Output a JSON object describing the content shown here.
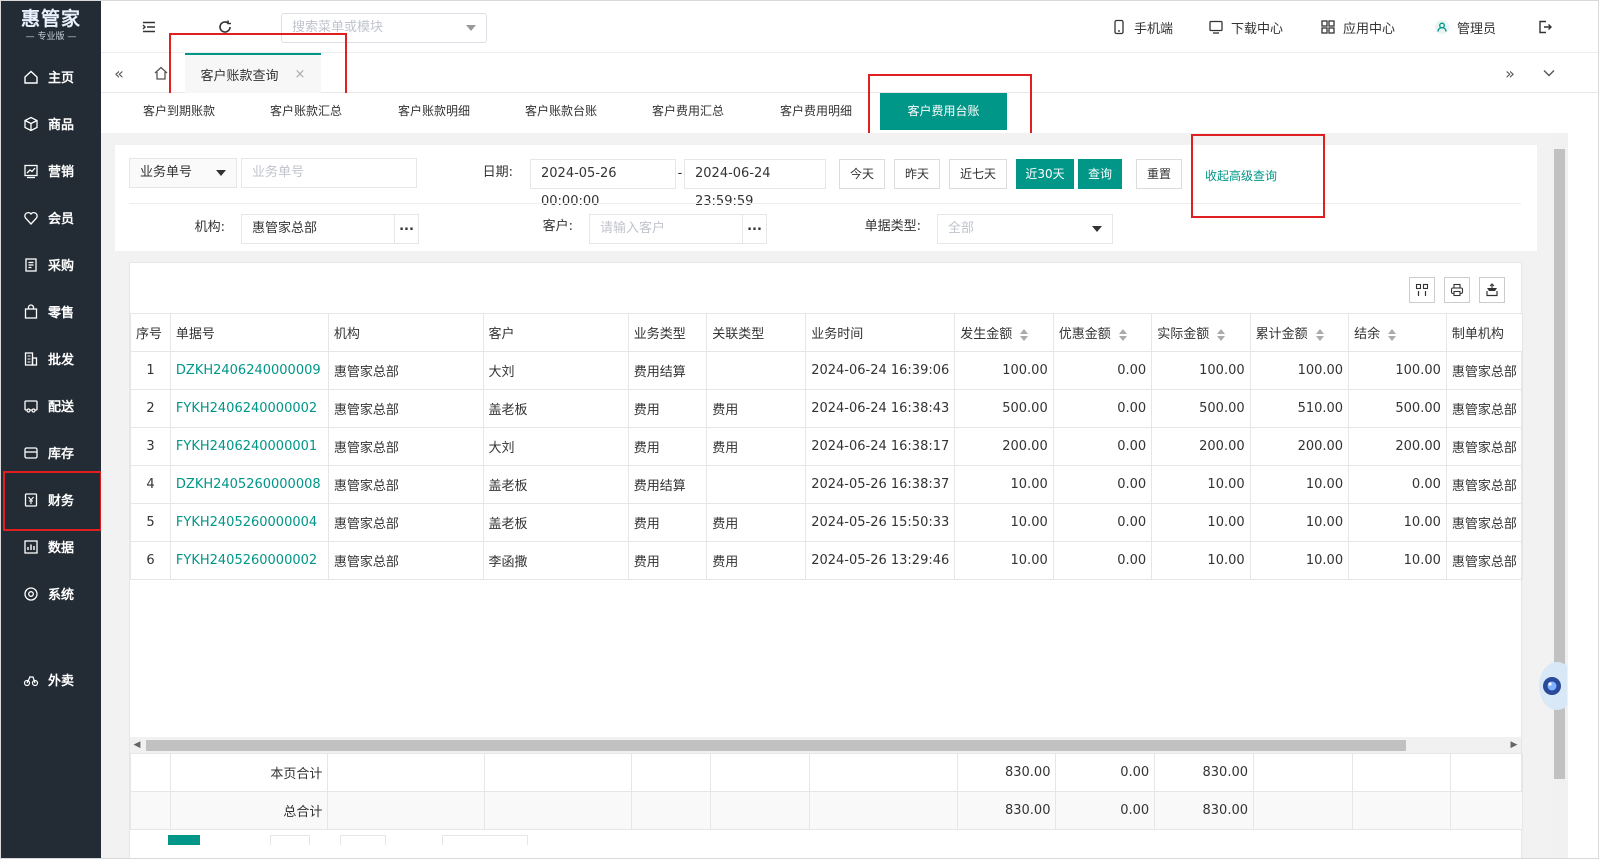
{
  "logo": {
    "main": "惠管家",
    "sub": "— 专业版 —"
  },
  "sidebar": {
    "items": [
      {
        "label": "主页",
        "icon": "home-icon"
      },
      {
        "label": "商品",
        "icon": "box-icon"
      },
      {
        "label": "营销",
        "icon": "chart-icon"
      },
      {
        "label": "会员",
        "icon": "heart-icon"
      },
      {
        "label": "采购",
        "icon": "purchase-icon"
      },
      {
        "label": "零售",
        "icon": "bag-icon"
      },
      {
        "label": "批发",
        "icon": "building-icon"
      },
      {
        "label": "配送",
        "icon": "delivery-icon"
      },
      {
        "label": "库存",
        "icon": "inventory-icon"
      },
      {
        "label": "财务",
        "icon": "yuan-icon"
      },
      {
        "label": "数据",
        "icon": "data-icon"
      },
      {
        "label": "系统",
        "icon": "settings-icon"
      },
      {
        "label": "外卖",
        "icon": "bike-icon"
      }
    ]
  },
  "header": {
    "search_placeholder": "搜索菜单或模块",
    "mobile": "手机端",
    "download": "下载中心",
    "apps": "应用中心",
    "user": "管理员"
  },
  "tabbar": {
    "active_tab": "客户账款查询",
    "close": "×"
  },
  "subtabs": [
    "客户到期账款",
    "客户账款汇总",
    "客户账款明细",
    "客户账款台账",
    "客户费用汇总",
    "客户费用明细",
    "客户费用台账"
  ],
  "filters": {
    "field_select": "业务单号",
    "field_placeholder": "业务单号",
    "date_label": "日期:",
    "date_start": "2024-05-26 00:00:00",
    "date_sep": "-",
    "date_end": "2024-06-24 23:59:59",
    "today": "今天",
    "yesterday": "昨天",
    "last7": "近七天",
    "last30": "近30天",
    "query": "查询",
    "reset": "重置",
    "collapse": "收起高级查询",
    "org_label": "机构:",
    "org_value": "惠管家总部",
    "customer_label": "客户:",
    "customer_placeholder": "请输入客户",
    "doctype_label": "单据类型:",
    "doctype_value": "全部",
    "dots": "..."
  },
  "table": {
    "columns": [
      "序号",
      "单据号",
      "机构",
      "客户",
      "业务类型",
      "关联类型",
      "业务时间",
      "发生金额",
      "优惠金额",
      "实际金额",
      "累计金额",
      "结余",
      "制单机构"
    ],
    "rows": [
      [
        "1",
        "DZKH2406240000009",
        "惠管家总部",
        "大刘",
        "费用结算",
        "",
        "2024-06-24 16:39:06",
        "100.00",
        "0.00",
        "100.00",
        "100.00",
        "100.00",
        "惠管家总部"
      ],
      [
        "2",
        "FYKH2406240000002",
        "惠管家总部",
        "盖老板",
        "费用",
        "费用",
        "2024-06-24 16:38:43",
        "500.00",
        "0.00",
        "500.00",
        "510.00",
        "500.00",
        "惠管家总部"
      ],
      [
        "3",
        "FYKH2406240000001",
        "惠管家总部",
        "大刘",
        "费用",
        "费用",
        "2024-06-24 16:38:17",
        "200.00",
        "0.00",
        "200.00",
        "200.00",
        "200.00",
        "惠管家总部"
      ],
      [
        "4",
        "DZKH2405260000008",
        "惠管家总部",
        "盖老板",
        "费用结算",
        "",
        "2024-05-26 16:38:37",
        "10.00",
        "0.00",
        "10.00",
        "10.00",
        "0.00",
        "惠管家总部"
      ],
      [
        "5",
        "FYKH2405260000004",
        "惠管家总部",
        "盖老板",
        "费用",
        "费用",
        "2024-05-26 15:50:33",
        "10.00",
        "0.00",
        "10.00",
        "10.00",
        "10.00",
        "惠管家总部"
      ],
      [
        "6",
        "FYKH2405260000002",
        "惠管家总部",
        "李函撒",
        "费用",
        "费用",
        "2024-05-26 13:29:46",
        "10.00",
        "0.00",
        "10.00",
        "10.00",
        "10.00",
        "惠管家总部"
      ]
    ],
    "totals": [
      {
        "label": "本页合计",
        "amount": "830.00",
        "discount": "0.00",
        "actual": "830.00"
      },
      {
        "label": "总合计",
        "amount": "830.00",
        "discount": "0.00",
        "actual": "830.00"
      }
    ]
  },
  "colors": {
    "sidebar": "#232b34",
    "accent": "#009688",
    "highlight": "#e02020"
  }
}
